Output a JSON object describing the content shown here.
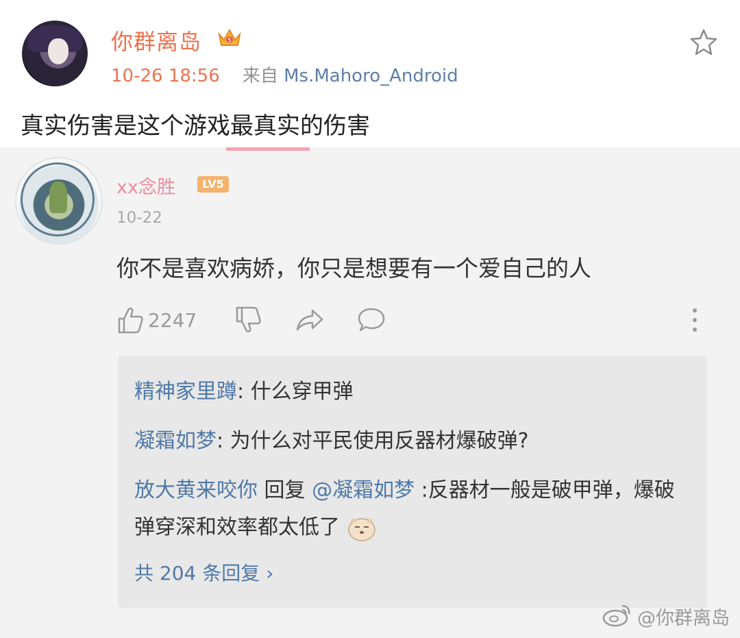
{
  "post": {
    "username": "你群离岛",
    "time": "10-26 18:56",
    "source_prefix": "来自",
    "source": "Ms.Mahoro_Android",
    "text": "真实伤害是这个游戏最真实的伤害"
  },
  "comment": {
    "username": "xx念胜",
    "level_badge": "LV5",
    "date": "10-22",
    "text": "你不是喜欢病娇，你只是想要有一个爱自己的人",
    "like_count": "2247",
    "replies": [
      {
        "name": "精神家里蹲",
        "text": ": 什么穿甲弹"
      },
      {
        "name": "凝霜如梦",
        "text": ": 为什么对平民使用反器材爆破弹?"
      },
      {
        "name": "放大黄来咬你",
        "middle": " 回复 ",
        "mention": "@凝霜如梦",
        "text": " :反器材一般是破甲弹，爆破弹穿深和效率都太低了"
      }
    ],
    "reply_count_label": "共 204 条回复 ›"
  },
  "watermark": "@你群离岛",
  "colors": {
    "accent": "#eb7350",
    "link_blue": "#4f79a8",
    "pink_name": "#f08aa0"
  }
}
